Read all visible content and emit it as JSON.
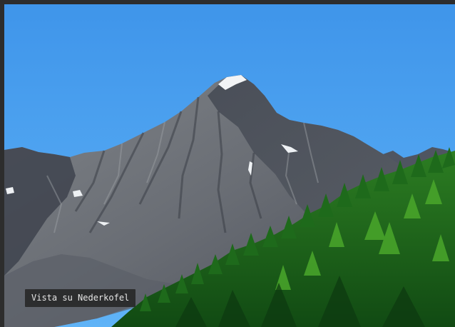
{
  "image": {
    "caption": "Vista su Nederkofel",
    "colors": {
      "sky_top": "#3f95ea",
      "sky_bottom": "#59b0f6",
      "rock_light": "#8b8e92",
      "rock_mid": "#5f636a",
      "rock_dark": "#3a3e47",
      "snow": "#f2f4f6",
      "forest_dark": "#0f3f12",
      "forest_mid": "#1f6f1c",
      "forest_light": "#48a629"
    }
  }
}
